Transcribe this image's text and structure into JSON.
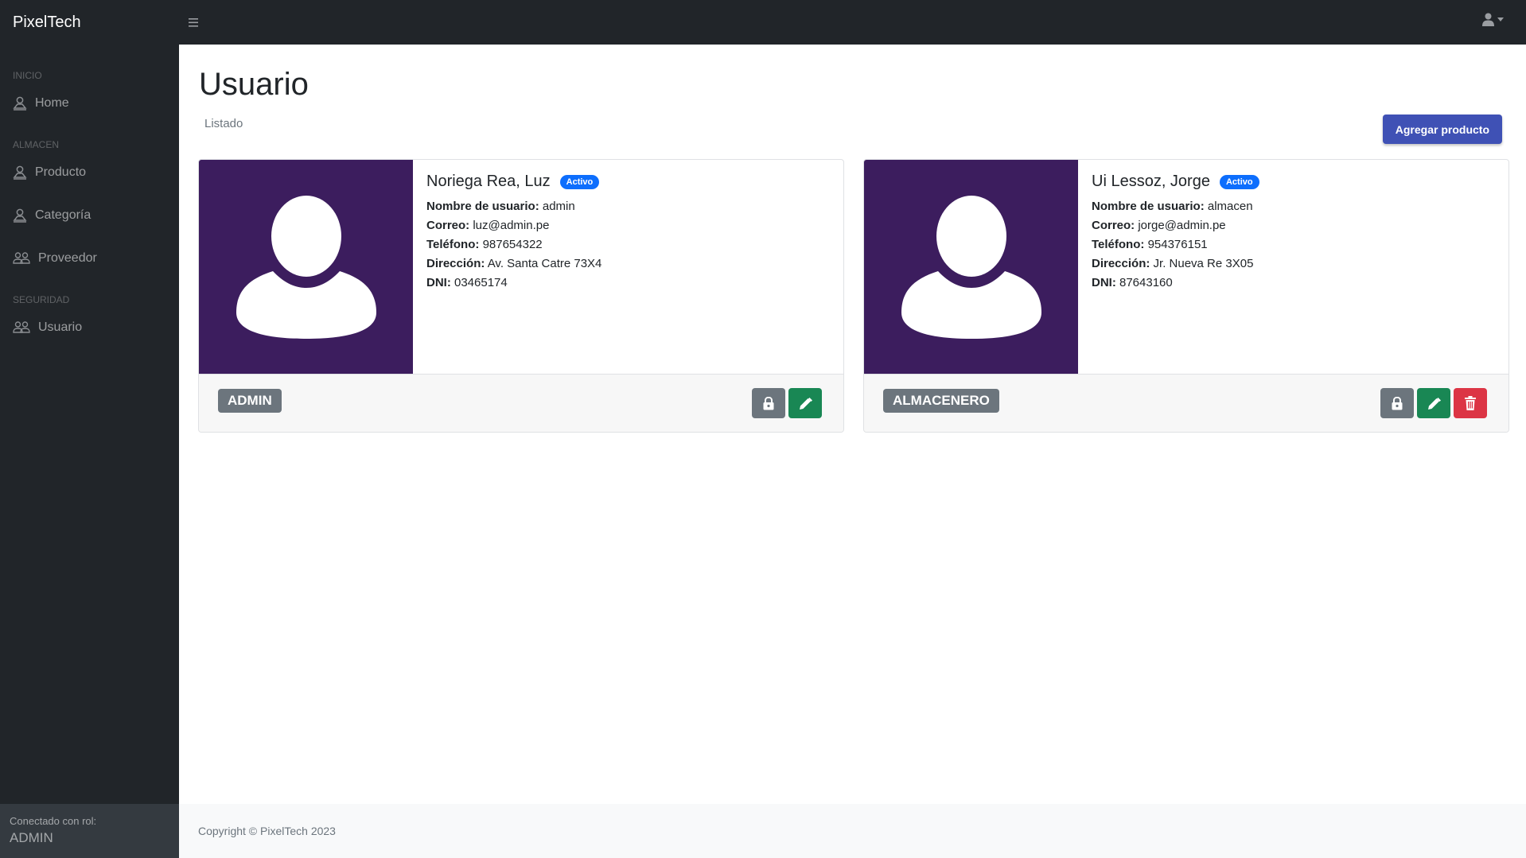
{
  "app": {
    "brand": "PixelTech"
  },
  "sidebar": {
    "sections": [
      {
        "heading": "INICIO",
        "items": [
          {
            "label": "Home",
            "icon": "person-icon"
          }
        ]
      },
      {
        "heading": "ALMACEN",
        "items": [
          {
            "label": "Producto",
            "icon": "person-icon"
          },
          {
            "label": "Categoría",
            "icon": "person-icon"
          },
          {
            "label": "Proveedor",
            "icon": "users-icon"
          }
        ]
      },
      {
        "heading": "SEGURIDAD",
        "items": [
          {
            "label": "Usuario",
            "icon": "users-icon"
          }
        ]
      }
    ],
    "footer": {
      "label": "Conectado con rol:",
      "role": "ADMIN"
    }
  },
  "header": {
    "title": "Usuario",
    "breadcrumb": "Listado",
    "add_button": "Agregar producto"
  },
  "field_labels": {
    "username": "Nombre de usuario:",
    "email": "Correo:",
    "phone": "Teléfono:",
    "address": "Dirección:",
    "dni": "DNI:"
  },
  "users": [
    {
      "name": "Noriega Rea, Luz",
      "status": "Activo",
      "username": "admin",
      "email": "luz@admin.pe",
      "phone": "987654322",
      "address": "Av. Santa Catre 73X4",
      "dni": "03465174",
      "role": "ADMIN",
      "actions": [
        "lock-icon",
        "pencil-icon"
      ]
    },
    {
      "name": "Ui Lessoz, Jorge",
      "status": "Activo",
      "username": "almacen",
      "email": "jorge@admin.pe",
      "phone": "954376151",
      "address": "Jr. Nueva Re 3X05",
      "dni": "87643160",
      "role": "ALMACENERO",
      "actions": [
        "lock-icon",
        "pencil-icon",
        "trash-icon"
      ]
    }
  ],
  "footer": {
    "copyright": "Copyright © PixelTech 2023"
  },
  "colors": {
    "nav_bg": "#212529",
    "avatar_bg": "#3c1d5e",
    "primary_button": "#3f51b5",
    "active_badge": "#0d6efd",
    "role_badge": "#6c757d",
    "edit_button": "#198754",
    "delete_button": "#dc3545"
  }
}
